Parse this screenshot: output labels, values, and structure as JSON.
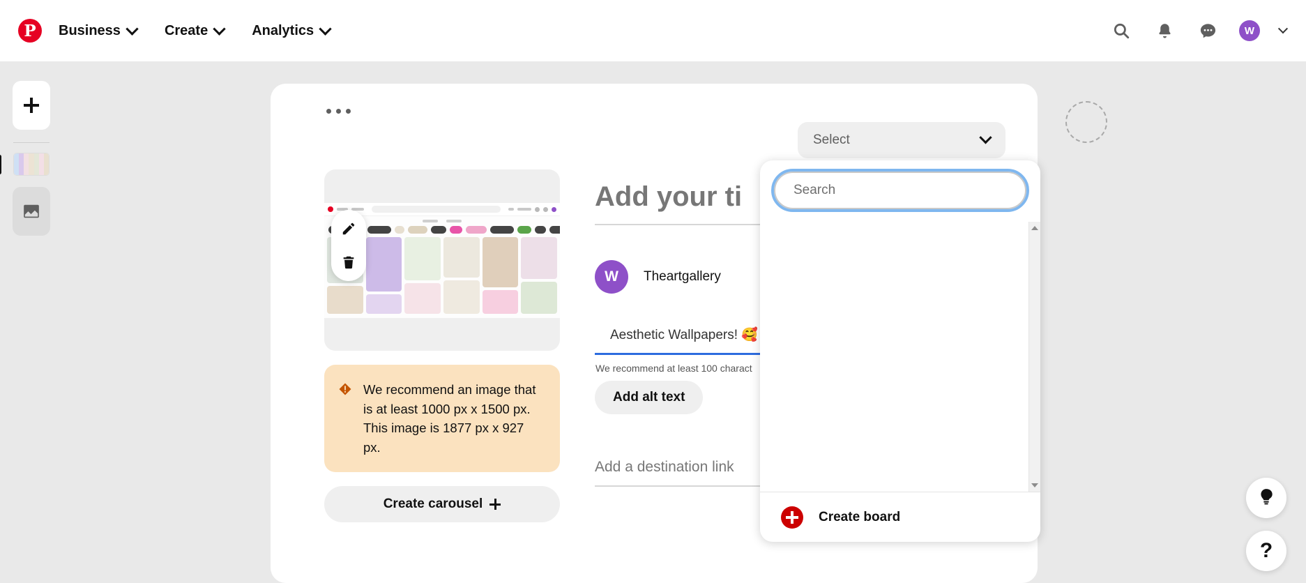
{
  "header": {
    "logo": "pinterest-logo",
    "nav": [
      {
        "label": "Business",
        "icon": "chevron-down-icon"
      },
      {
        "label": "Create",
        "icon": "chevron-down-icon"
      },
      {
        "label": "Analytics",
        "icon": "chevron-down-icon"
      }
    ],
    "actions": [
      {
        "name": "search-icon"
      },
      {
        "name": "notifications-bell-icon"
      },
      {
        "name": "messages-icon"
      }
    ],
    "avatar_initial": "W",
    "account_chevron": "chevron-down-icon"
  },
  "rail": {
    "add_label": "+",
    "thumb_name": "pin-thumbnail",
    "image_slot_name": "image-placeholder"
  },
  "card": {
    "overflow_menu": "more-options-icon",
    "media": {
      "edit_icon": "pencil-icon",
      "delete_icon": "trash-icon",
      "warning": {
        "icon": "warning-icon",
        "text": "We recommend an image that is at least 1000 px x 1500 px. This image is 1877 px x 927 px."
      },
      "carousel_button": "Create carousel"
    },
    "form": {
      "title_placeholder": "Add your ti",
      "author": {
        "initial": "W",
        "name": "Theartgallery"
      },
      "description_value": "Aesthetic Wallpapers! 🥰",
      "description_hint": "We recommend at least 100 charact",
      "alt_text_button": "Add alt text",
      "destination_placeholder": "Add a destination link"
    }
  },
  "board_select": {
    "label": "Select",
    "chevron": "chevron-down-icon",
    "dropdown": {
      "search_placeholder": "Search",
      "search_value": "",
      "create_board_label": "Create board",
      "create_board_icon": "plus-circle-icon",
      "scrollbar": {
        "up": "scroll-up-arrow",
        "down": "scroll-down-arrow"
      }
    }
  },
  "floating": {
    "idea_icon": "lightbulb-icon",
    "help_label": "?"
  },
  "spinner": "loading-spinner",
  "colors": {
    "brand_red": "#e60023",
    "create_red": "#cc0000",
    "avatar_purple": "#8e50c8",
    "warning_bg": "#fbe2bf",
    "warning_icon": "#c45500",
    "focus_blue": "#7fb7ef",
    "underline_blue": "#2d6cdf",
    "page_bg": "#e9e9e9"
  }
}
